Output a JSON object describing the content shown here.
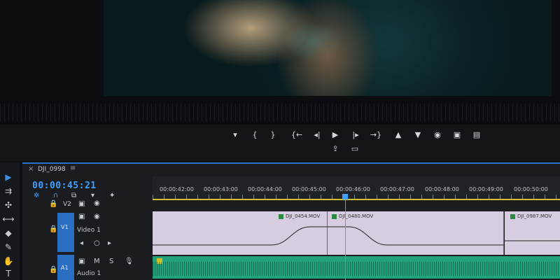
{
  "sequence": {
    "tab_title": "DJI_0998",
    "tab_close": "×",
    "tab_menu": "≡",
    "timecode": "00:00:45:21"
  },
  "ruler": {
    "labels": [
      "00:00:42:00",
      "00:00:43:00",
      "00:00:44:00",
      "00:00:45:00",
      "00:00:46:00",
      "00:00:47:00",
      "00:00:48:00",
      "00:00:49:00",
      "00:00:50:00"
    ]
  },
  "tracks": {
    "v2": {
      "target": "V2"
    },
    "v1": {
      "target": "V1",
      "name": "Video 1"
    },
    "a1": {
      "target": "A1",
      "name": "Audio 1"
    }
  },
  "clips": [
    {
      "name": "DJI_0454.MOV"
    },
    {
      "name": "DJI_0480.MOV"
    },
    {
      "name": "DJI_0987.MOV"
    }
  ],
  "transport": {
    "mark_in": "▾",
    "mark_in_bracket": "{",
    "mark_out_bracket": "}",
    "go_to_in": "{←",
    "step_back": "◂|",
    "play": "▶",
    "step_forward": "|▸",
    "go_to_out": "→}",
    "lift": "▲",
    "extract": "▼",
    "export_frame": "◉",
    "insert": "▣",
    "overwrite": "▤",
    "export": "⇪",
    "safe_margins": "▭"
  },
  "tools": [
    "▶",
    "⇉",
    "✣",
    "⟷",
    "◆",
    "✎",
    "✋",
    "T"
  ],
  "colors": {
    "accent_blue": "#3fa0ff",
    "timeline_border": "#2a72c8",
    "video_clip": "#d6cde0",
    "audio_clip": "#23a07c",
    "work_area": "#d2c030"
  }
}
